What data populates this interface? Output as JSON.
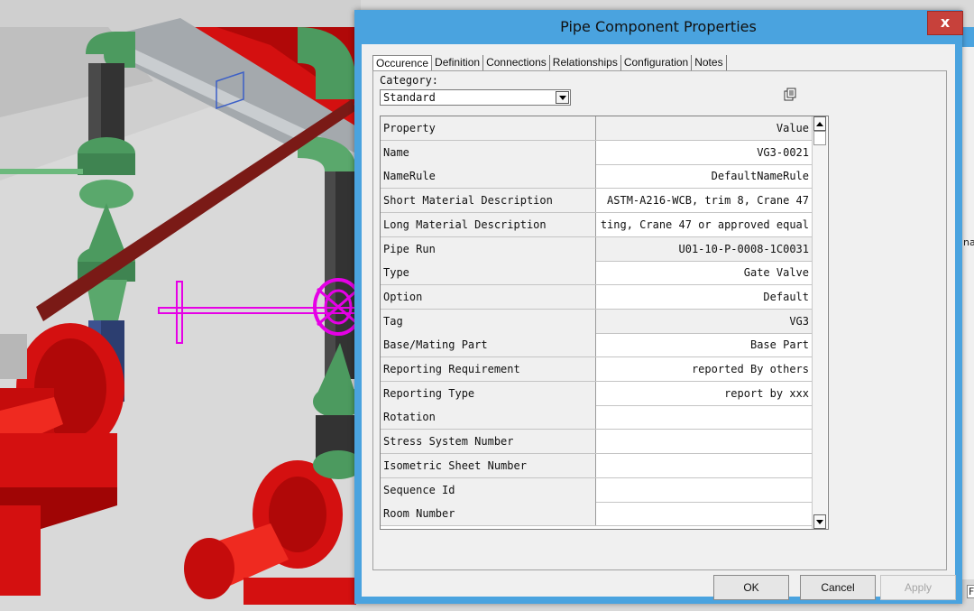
{
  "dialog": {
    "title": "Pipe Component Properties",
    "close_glyph": "x",
    "tabs": [
      {
        "label": "Occurence",
        "active": true
      },
      {
        "label": "Definition",
        "active": false
      },
      {
        "label": "Connections",
        "active": false
      },
      {
        "label": "Relationships",
        "active": false
      },
      {
        "label": "Configuration",
        "active": false
      },
      {
        "label": "Notes",
        "active": false
      }
    ],
    "category": {
      "label": "Category:",
      "selected": "Standard"
    },
    "grid": {
      "header": {
        "property": "Property",
        "value": "Value"
      },
      "rows": [
        {
          "name": "Name",
          "value": "VG3-0021",
          "readonly": false
        },
        {
          "name": "NameRule",
          "value": "DefaultNameRule",
          "readonly": false
        },
        {
          "name": "Short Material Description",
          "value": "ASTM-A216-WCB, trim 8, Crane 47",
          "readonly": false
        },
        {
          "name": "Long Material Description",
          "value": "ting, Crane 47 or approved equal",
          "readonly": false
        },
        {
          "name": "Pipe Run",
          "value": "U01-10-P-0008-1C0031",
          "readonly": true
        },
        {
          "name": "Type",
          "value": "Gate Valve",
          "readonly": false
        },
        {
          "name": "Option",
          "value": "Default",
          "readonly": false
        },
        {
          "name": "Tag",
          "value": "VG3",
          "readonly": true
        },
        {
          "name": "Base/Mating Part",
          "value": "Base Part",
          "readonly": false
        },
        {
          "name": "Reporting Requirement",
          "value": "reported By others",
          "readonly": false
        },
        {
          "name": "Reporting Type",
          "value": "report by xxx",
          "readonly": false
        },
        {
          "name": "Rotation",
          "value": "",
          "readonly": false
        },
        {
          "name": "Stress System Number",
          "value": "",
          "readonly": false
        },
        {
          "name": "Isometric Sheet Number",
          "value": "",
          "readonly": false
        },
        {
          "name": "Sequence Id",
          "value": "",
          "readonly": false
        },
        {
          "name": "Room Number",
          "value": "",
          "readonly": false
        }
      ]
    },
    "buttons": {
      "ok": "OK",
      "cancel": "Cancel",
      "apply": "Apply"
    }
  },
  "background": {
    "edge_text": "na",
    "edge_text_bottom": "F"
  },
  "colors": {
    "titlebar": "#4aa3df",
    "close": "#c7413b",
    "pipe_red": "#e8170f",
    "pipe_green": "#4f9a62",
    "pipe_gray": "#9ea4a8",
    "selection_magenta": "#e600e6"
  }
}
